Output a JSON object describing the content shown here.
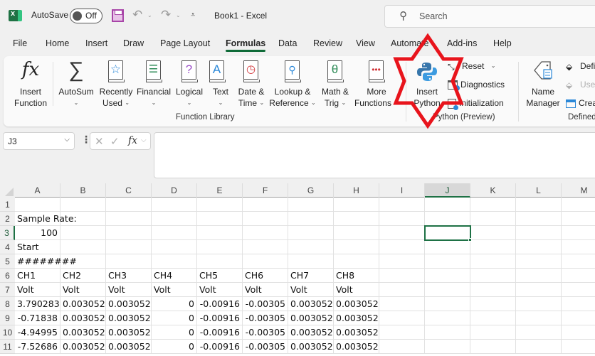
{
  "titlebar": {
    "app_icon": "excel-icon",
    "autosave_label": "AutoSave",
    "autosave_state": "Off",
    "document_title": "Book1  -  Excel",
    "search_placeholder": "Search"
  },
  "tabs": [
    {
      "label": "File",
      "active": false
    },
    {
      "label": "Home",
      "active": false
    },
    {
      "label": "Insert",
      "active": false
    },
    {
      "label": "Draw",
      "active": false
    },
    {
      "label": "Page Layout",
      "active": false
    },
    {
      "label": "Formulas",
      "active": true
    },
    {
      "label": "Data",
      "active": false
    },
    {
      "label": "Review",
      "active": false
    },
    {
      "label": "View",
      "active": false
    },
    {
      "label": "Automate",
      "active": false
    },
    {
      "label": "Add-ins",
      "active": false
    },
    {
      "label": "Help",
      "active": false
    }
  ],
  "ribbon": {
    "insert_function": {
      "line1": "Insert",
      "line2": "Function"
    },
    "function_library": {
      "label": "Function Library",
      "buttons": [
        {
          "line1": "AutoSum",
          "line2": "",
          "icon": "sigma-icon"
        },
        {
          "line1": "Recently",
          "line2": "Used",
          "icon": "star-book-icon"
        },
        {
          "line1": "Financial",
          "line2": "",
          "icon": "coins-book-icon"
        },
        {
          "line1": "Logical",
          "line2": "",
          "icon": "question-book-icon"
        },
        {
          "line1": "Text",
          "line2": "",
          "icon": "text-book-icon"
        },
        {
          "line1": "Date &",
          "line2": "Time",
          "icon": "clock-book-icon"
        },
        {
          "line1": "Lookup &",
          "line2": "Reference",
          "icon": "magnifier-book-icon"
        },
        {
          "line1": "Math &",
          "line2": "Trig",
          "icon": "theta-book-icon"
        },
        {
          "line1": "More",
          "line2": "Functions",
          "icon": "more-book-icon"
        }
      ]
    },
    "python": {
      "label": "Python (Preview)",
      "insert_line1": "Insert",
      "insert_line2": "Python",
      "reset": "Reset",
      "diagnostics": "Diagnostics",
      "initialization": "Initialization"
    },
    "defined_names": {
      "label": "Defined",
      "name_manager_line1": "Name",
      "name_manager_line2": "Manager",
      "define": "Defi",
      "use": "Use",
      "create": "Crea"
    }
  },
  "formula_bar": {
    "name_box": "J3",
    "cancel_glyph": "✕",
    "enter_glyph": "✓",
    "fx_label": "fx",
    "formula_value": ""
  },
  "sheet": {
    "columns": [
      "A",
      "B",
      "C",
      "D",
      "E",
      "F",
      "G",
      "H",
      "I",
      "J",
      "K",
      "L",
      "M"
    ],
    "selected_column": "J",
    "rows": [
      "1",
      "2",
      "3",
      "4",
      "5",
      "6",
      "7",
      "8",
      "9",
      "10",
      "11"
    ],
    "selected_row": "3",
    "selected_cell": "J3",
    "cells": {
      "A2": "Sample Rate:",
      "A3": "100",
      "A4": "Start",
      "A5": "########",
      "row6": [
        "CH1",
        "CH2",
        "CH3",
        "CH4",
        "CH5",
        "CH6",
        "CH7",
        "CH8"
      ],
      "row7": [
        "Volt",
        "Volt",
        "Volt",
        "Volt",
        "Volt",
        "Volt",
        "Volt",
        "Volt"
      ],
      "row8": [
        "3.790283",
        "0.003052",
        "0.003052",
        "0",
        "-0.00916",
        "-0.00305",
        "0.003052",
        "0.003052"
      ],
      "row9": [
        "-0.71838",
        "0.003052",
        "0.003052",
        "0",
        "-0.00916",
        "-0.00305",
        "0.003052",
        "0.003052"
      ],
      "row10": [
        "-4.94995",
        "0.003052",
        "0.003052",
        "0",
        "-0.00916",
        "-0.00305",
        "0.003052",
        "0.003052"
      ],
      "row11": [
        "-7.52686",
        "0.003052",
        "0.003052",
        "0",
        "-0.00916",
        "-0.00305",
        "0.003052",
        "0.003052"
      ]
    }
  },
  "annotation": {
    "shape": "six-pointed-star",
    "color": "#e8141c",
    "target": "Insert Python"
  }
}
